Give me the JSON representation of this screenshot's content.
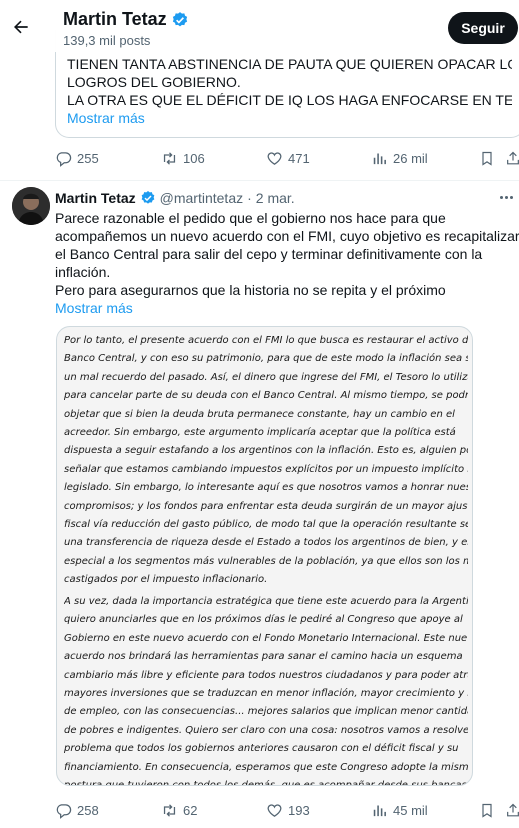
{
  "header": {
    "name": "Martin Tetaz",
    "posts": "139,3 mil posts",
    "follow_label": "Seguir"
  },
  "tweet1": {
    "quote_lines": [
      "TIENEN TANTA ABSTINENCIA DE PAUTA QUE QUIEREN OPACAR LOS",
      "LOGROS DEL GOBIERNO.",
      "LA OTRA ES QUE EL DÉFICIT DE IQ LOS HAGA ENFOCARSE EN TEMA…"
    ],
    "show_more": "Mostrar más",
    "replies": "255",
    "retweets": "106",
    "likes": "471",
    "views": "26 mil"
  },
  "tweet2": {
    "name": "Martin Tetaz",
    "handle": "@martintetaz",
    "sep": "·",
    "date": "2 mar.",
    "lines": [
      "Parece razonable el pedido que el gobierno nos hace para que",
      "acompañemos un nuevo acuerdo con el FMI, cuyo objetivo es recapitalizar",
      "el Banco Central para salir del cepo y terminar definitivamente con la",
      "inflación.",
      "Pero para asegurarnos que la historia no se repita y el próximo"
    ],
    "show_more": "Mostrar más",
    "doc_para1": [
      "Por lo tanto, el presente acuerdo con el FMI lo que busca es restaurar el activo del",
      "Banco Central, y con eso su patrimonio, para que de este modo la inflación sea solo",
      "un mal recuerdo del pasado. Así, el dinero que ingrese del FMI, el Tesoro lo utilizará",
      "para cancelar parte de su deuda con el Banco Central. Al mismo tiempo, se podría",
      "objetar que si bien la deuda bruta permanece constante, hay un cambio en el",
      "acreedor. Sin embargo, este argumento implicaría aceptar que la política está",
      "dispuesta a seguir estafando a los argentinos con la inflación. Esto es, alguien podría",
      "señalar que estamos cambiando impuestos explícitos por un impuesto implícito no",
      "legislado. Sin embargo, lo interesante aquí es que nosotros vamos a honrar nuestros",
      "compromisos; y los fondos para enfrentar esta deuda surgirán de un mayor ajuste",
      "fiscal vía reducción del gasto público, de modo tal que la operación resultante sea",
      "una transferencia de riqueza desde el Estado a todos los argentinos de bien, y en",
      "especial a los segmentos más vulnerables de la población, ya que ellos son los más",
      "castigados por el impuesto inflacionario."
    ],
    "doc_para2": [
      "A su vez, dada la importancia estratégica que tiene este acuerdo para la Argentina,",
      "quiero anunciarles que en los próximos días le pediré al Congreso que apoye al",
      "Gobierno en este nuevo acuerdo con el Fondo Monetario Internacional. Este nuevo",
      "acuerdo nos brindará las herramientas para sanar el camino hacia un esquema",
      "cambiario más libre y eficiente para todos nuestros ciudadanos y para poder atraer",
      "mayores inversiones que se traduzcan en menor inflación, mayor crecimiento y nivel",
      "de empleo, con las consecuencias... mejores salarios que implican menor cantidad",
      "de pobres e indigentes. Quiero ser claro con una cosa: nosotros vamos a resolver el",
      "problema que todos los gobiernos anteriores causaron con el déficit fiscal y su",
      "financiamiento. En consecuencia, esperamos que este Congreso adopte la misma",
      "postura que tuvieron con todos los demás, que es acompañar desde sus bancas,"
    ],
    "replies": "258",
    "retweets": "62",
    "likes": "193",
    "views": "45 mil"
  },
  "colors": {
    "accent": "#1d9bf0",
    "text": "#0f1419",
    "muted": "#536471",
    "verified": "#1d9bf0"
  },
  "icons": [
    "back-arrow-icon",
    "verified-badge-icon",
    "reply-icon",
    "retweet-icon",
    "like-icon",
    "views-icon",
    "bookmark-icon",
    "share-icon",
    "more-icon"
  ]
}
